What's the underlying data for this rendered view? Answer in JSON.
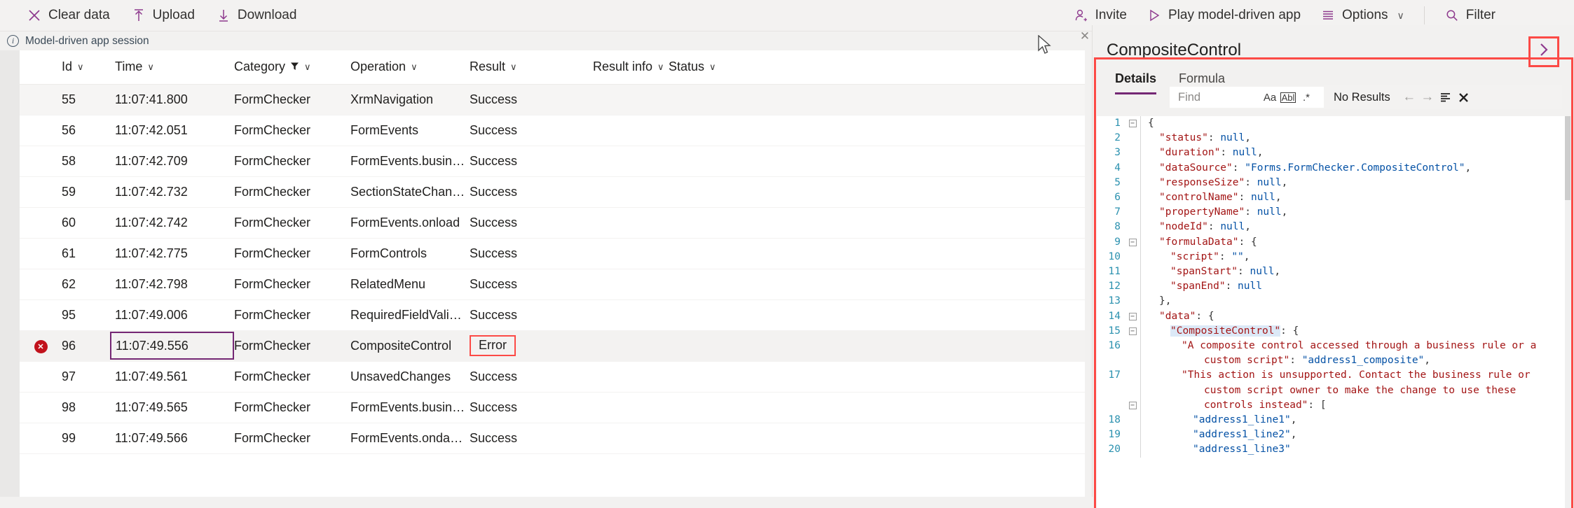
{
  "toolbar": {
    "left_items": [
      {
        "label": "Clear data",
        "icon": "close-x-icon"
      },
      {
        "label": "Upload",
        "icon": "upload-arrow-icon"
      },
      {
        "label": "Download",
        "icon": "download-arrow-icon"
      }
    ],
    "right_items": [
      {
        "label": "Invite",
        "icon": "add-person-icon"
      },
      {
        "label": "Play model-driven app",
        "icon": "play-triangle-icon"
      },
      {
        "label": "Options",
        "icon": "options-lines-icon",
        "chevron": "∨"
      },
      {
        "label": "Filter",
        "icon": "search-magnifier-icon"
      }
    ],
    "accent_color": "#8e3a8e"
  },
  "session_bar": {
    "icon": "info-circle-icon",
    "label": "Model-driven app session",
    "close_icon": "✕"
  },
  "table": {
    "columns": [
      {
        "key": "id",
        "label": "Id",
        "chevron": "∨",
        "filtered": false
      },
      {
        "key": "time",
        "label": "Time",
        "chevron": "∨",
        "filtered": false
      },
      {
        "key": "category",
        "label": "Category",
        "chevron": "∨",
        "filtered": true,
        "filter_icon": "funnel-icon"
      },
      {
        "key": "operation",
        "label": "Operation",
        "chevron": "∨",
        "filtered": false
      },
      {
        "key": "result",
        "label": "Result",
        "chevron": "∨",
        "filtered": false
      },
      {
        "key": "result_info",
        "label": "Result info",
        "chevron": "∨",
        "filtered": false
      },
      {
        "key": "status",
        "label": "Status",
        "chevron": "∨",
        "filtered": false
      }
    ],
    "rows": [
      {
        "id": "55",
        "time": "11:07:41.800",
        "category": "FormChecker",
        "operation": "XrmNavigation",
        "result": "Success",
        "result_info": "",
        "status": "",
        "state": "alt",
        "error": false
      },
      {
        "id": "56",
        "time": "11:07:42.051",
        "category": "FormChecker",
        "operation": "FormEvents",
        "result": "Success",
        "result_info": "",
        "status": "",
        "state": "",
        "error": false
      },
      {
        "id": "58",
        "time": "11:07:42.709",
        "category": "FormChecker",
        "operation": "FormEvents.businessrule",
        "result": "Success",
        "result_info": "",
        "status": "",
        "state": "",
        "error": false
      },
      {
        "id": "59",
        "time": "11:07:42.732",
        "category": "FormChecker",
        "operation": "SectionStateChange.vi...",
        "result": "Success",
        "result_info": "",
        "status": "",
        "state": "",
        "error": false
      },
      {
        "id": "60",
        "time": "11:07:42.742",
        "category": "FormChecker",
        "operation": "FormEvents.onload",
        "result": "Success",
        "result_info": "",
        "status": "",
        "state": "",
        "error": false
      },
      {
        "id": "61",
        "time": "11:07:42.775",
        "category": "FormChecker",
        "operation": "FormControls",
        "result": "Success",
        "result_info": "",
        "status": "",
        "state": "",
        "error": false
      },
      {
        "id": "62",
        "time": "11:07:42.798",
        "category": "FormChecker",
        "operation": "RelatedMenu",
        "result": "Success",
        "result_info": "",
        "status": "",
        "state": "",
        "error": false
      },
      {
        "id": "95",
        "time": "11:07:49.006",
        "category": "FormChecker",
        "operation": "RequiredFieldValidation",
        "result": "Success",
        "result_info": "",
        "status": "",
        "state": "",
        "error": false
      },
      {
        "id": "96",
        "time": "11:07:49.556",
        "category": "FormChecker",
        "operation": "CompositeControl",
        "result": "Error",
        "result_info": "",
        "status": "",
        "state": "sel",
        "error": true,
        "error_icon": "error-circle-icon",
        "time_selected": true,
        "result_annotated": true
      },
      {
        "id": "97",
        "time": "11:07:49.561",
        "category": "FormChecker",
        "operation": "UnsavedChanges",
        "result": "Success",
        "result_info": "",
        "status": "",
        "state": "",
        "error": false
      },
      {
        "id": "98",
        "time": "11:07:49.565",
        "category": "FormChecker",
        "operation": "FormEvents.businessrule",
        "result": "Success",
        "result_info": "",
        "status": "",
        "state": "",
        "error": false
      },
      {
        "id": "99",
        "time": "11:07:49.566",
        "category": "FormChecker",
        "operation": "FormEvents.ondataload",
        "result": "Success",
        "result_info": "",
        "status": "",
        "state": "",
        "error": false
      }
    ],
    "selection_border_color": "#742774",
    "annotation_color": "#fc4a46",
    "error_color": "#c1121c"
  },
  "panel": {
    "title": "CompositeControl",
    "expand_icon": "chevron-right-icon",
    "tabs": [
      {
        "label": "Details",
        "active": true
      },
      {
        "label": "Formula",
        "active": false
      }
    ],
    "find": {
      "placeholder": "Find",
      "value": "",
      "match_case_icon": "Aa",
      "whole_word_icon": "Abl",
      "regex_icon": ".*",
      "status": "No Results",
      "prev_icon": "←",
      "next_icon": "→",
      "find_in_selection_icon": "selection-find-icon",
      "close_icon": "✕"
    },
    "code_colors": {
      "line_number": "#2b91af",
      "key": "#a31515",
      "string_value": "#a31515",
      "keyword_null": "#0451a5",
      "highlight": "#dce9f7"
    },
    "code_lines": [
      {
        "num": "1",
        "fold": "minus",
        "indent": 0,
        "tokens": [
          {
            "t": "{",
            "c": "p"
          }
        ]
      },
      {
        "num": "2",
        "fold": "",
        "indent": 1,
        "tokens": [
          {
            "t": "\"status\"",
            "c": "k"
          },
          {
            "t": ": ",
            "c": "p"
          },
          {
            "t": "null",
            "c": "nl"
          },
          {
            "t": ",",
            "c": "p"
          }
        ]
      },
      {
        "num": "3",
        "fold": "",
        "indent": 1,
        "tokens": [
          {
            "t": "\"duration\"",
            "c": "k"
          },
          {
            "t": ": ",
            "c": "p"
          },
          {
            "t": "null",
            "c": "nl"
          },
          {
            "t": ",",
            "c": "p"
          }
        ]
      },
      {
        "num": "4",
        "fold": "",
        "indent": 1,
        "tokens": [
          {
            "t": "\"dataSource\"",
            "c": "k"
          },
          {
            "t": ": ",
            "c": "p"
          },
          {
            "t": "\"Forms.FormChecker.CompositeControl\"",
            "c": "sv"
          },
          {
            "t": ",",
            "c": "p"
          }
        ]
      },
      {
        "num": "5",
        "fold": "",
        "indent": 1,
        "tokens": [
          {
            "t": "\"responseSize\"",
            "c": "k"
          },
          {
            "t": ": ",
            "c": "p"
          },
          {
            "t": "null",
            "c": "nl"
          },
          {
            "t": ",",
            "c": "p"
          }
        ]
      },
      {
        "num": "6",
        "fold": "",
        "indent": 1,
        "tokens": [
          {
            "t": "\"controlName\"",
            "c": "k"
          },
          {
            "t": ": ",
            "c": "p"
          },
          {
            "t": "null",
            "c": "nl"
          },
          {
            "t": ",",
            "c": "p"
          }
        ]
      },
      {
        "num": "7",
        "fold": "",
        "indent": 1,
        "tokens": [
          {
            "t": "\"propertyName\"",
            "c": "k"
          },
          {
            "t": ": ",
            "c": "p"
          },
          {
            "t": "null",
            "c": "nl"
          },
          {
            "t": ",",
            "c": "p"
          }
        ]
      },
      {
        "num": "8",
        "fold": "",
        "indent": 1,
        "tokens": [
          {
            "t": "\"nodeId\"",
            "c": "k"
          },
          {
            "t": ": ",
            "c": "p"
          },
          {
            "t": "null",
            "c": "nl"
          },
          {
            "t": ",",
            "c": "p"
          }
        ]
      },
      {
        "num": "9",
        "fold": "minus",
        "indent": 1,
        "tokens": [
          {
            "t": "\"formulaData\"",
            "c": "k"
          },
          {
            "t": ": {",
            "c": "p"
          }
        ]
      },
      {
        "num": "10",
        "fold": "",
        "indent": 2,
        "tokens": [
          {
            "t": "\"script\"",
            "c": "k"
          },
          {
            "t": ": ",
            "c": "p"
          },
          {
            "t": "\"\"",
            "c": "sv"
          },
          {
            "t": ",",
            "c": "p"
          }
        ]
      },
      {
        "num": "11",
        "fold": "",
        "indent": 2,
        "tokens": [
          {
            "t": "\"spanStart\"",
            "c": "k"
          },
          {
            "t": ": ",
            "c": "p"
          },
          {
            "t": "null",
            "c": "nl"
          },
          {
            "t": ",",
            "c": "p"
          }
        ]
      },
      {
        "num": "12",
        "fold": "",
        "indent": 2,
        "tokens": [
          {
            "t": "\"spanEnd\"",
            "c": "k"
          },
          {
            "t": ": ",
            "c": "p"
          },
          {
            "t": "null",
            "c": "nl"
          }
        ]
      },
      {
        "num": "13",
        "fold": "",
        "indent": 1,
        "tokens": [
          {
            "t": "},",
            "c": "p"
          }
        ]
      },
      {
        "num": "14",
        "fold": "minus",
        "indent": 1,
        "tokens": [
          {
            "t": "\"data\"",
            "c": "k"
          },
          {
            "t": ": {",
            "c": "p"
          }
        ]
      },
      {
        "num": "15",
        "fold": "minus",
        "indent": 2,
        "tokens": [
          {
            "t": "\"CompositeControl\"",
            "c": "k hl"
          },
          {
            "t": ": {",
            "c": "p"
          }
        ]
      },
      {
        "num": "16",
        "fold": "",
        "indent": 3,
        "tokens": [
          {
            "t": "\"A composite control accessed through a business rule or a",
            "c": "s"
          }
        ]
      },
      {
        "num": "",
        "fold": "",
        "indent": 5,
        "tokens": [
          {
            "t": "custom script\"",
            "c": "s"
          },
          {
            "t": ": ",
            "c": "p"
          },
          {
            "t": "\"address1_composite\"",
            "c": "sv"
          },
          {
            "t": ",",
            "c": "p"
          }
        ]
      },
      {
        "num": "17",
        "fold": "",
        "indent": 3,
        "tokens": [
          {
            "t": "\"This action is unsupported. Contact the business rule or",
            "c": "s"
          }
        ]
      },
      {
        "num": "",
        "fold": "",
        "indent": 5,
        "tokens": [
          {
            "t": "custom script owner to make the change to use these",
            "c": "s"
          }
        ]
      },
      {
        "num": "",
        "fold": "minus",
        "indent": 5,
        "tokens": [
          {
            "t": "controls instead\"",
            "c": "s"
          },
          {
            "t": ": [",
            "c": "p"
          }
        ]
      },
      {
        "num": "18",
        "fold": "",
        "indent": 4,
        "tokens": [
          {
            "t": "\"address1_line1\"",
            "c": "sv"
          },
          {
            "t": ",",
            "c": "p"
          }
        ]
      },
      {
        "num": "19",
        "fold": "",
        "indent": 4,
        "tokens": [
          {
            "t": "\"address1_line2\"",
            "c": "sv"
          },
          {
            "t": ",",
            "c": "p"
          }
        ]
      },
      {
        "num": "20",
        "fold": "",
        "indent": 4,
        "tokens": [
          {
            "t": "\"address1_line3\"",
            "c": "sv"
          }
        ]
      }
    ]
  }
}
